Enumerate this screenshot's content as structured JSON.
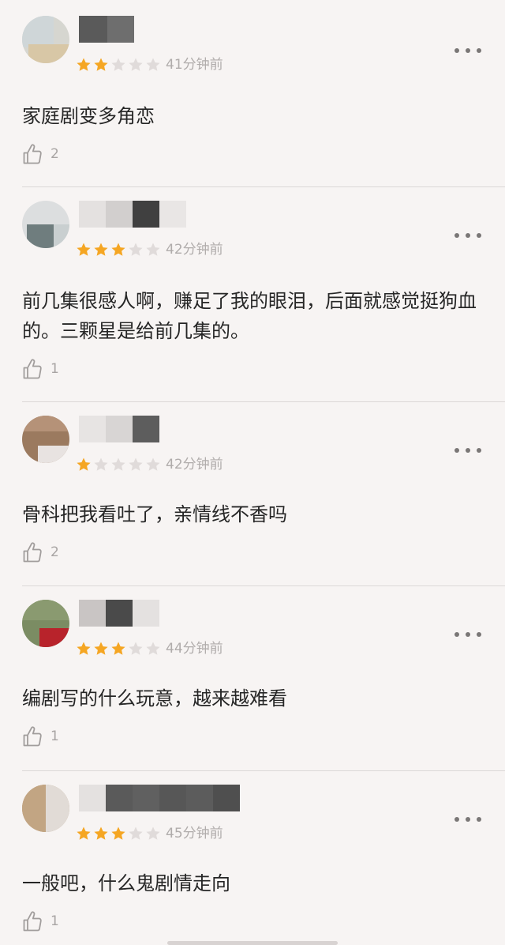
{
  "colors": {
    "background": "#f7f4f3",
    "star_filled": "#f5a623",
    "star_empty": "#e0dbda",
    "text": "#262626",
    "meta_text": "#b0acab",
    "divider": "#dcd8d7"
  },
  "icons": {
    "more": "more-dots-icon",
    "like": "thumbs-up-icon",
    "star": "star-icon"
  },
  "comments": [
    {
      "rating": 2,
      "max_rating": 5,
      "time": "41分钟前",
      "text": "家庭剧变多角恋",
      "likes": "2"
    },
    {
      "rating": 3,
      "max_rating": 5,
      "time": "42分钟前",
      "text": "前几集很感人啊，赚足了我的眼泪，后面就感觉挺狗血的。三颗星是给前几集的。",
      "likes": "1"
    },
    {
      "rating": 1,
      "max_rating": 5,
      "time": "42分钟前",
      "text": "骨科把我看吐了，亲情线不香吗",
      "likes": "2"
    },
    {
      "rating": 3,
      "max_rating": 5,
      "time": "44分钟前",
      "text": "编剧写的什么玩意，越来越难看",
      "likes": "1"
    },
    {
      "rating": 3,
      "max_rating": 5,
      "time": "45分钟前",
      "text": "一般吧，什么鬼剧情走向",
      "likes": "1"
    }
  ]
}
